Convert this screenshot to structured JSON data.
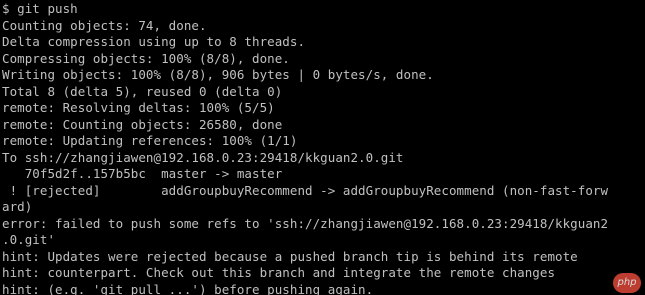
{
  "terminal": {
    "lines": [
      "$ git push",
      "Counting objects: 74, done.",
      "Delta compression using up to 8 threads.",
      "Compressing objects: 100% (8/8), done.",
      "Writing objects: 100% (8/8), 906 bytes | 0 bytes/s, done.",
      "Total 8 (delta 5), reused 0 (delta 0)",
      "remote: Resolving deltas: 100% (5/5)",
      "remote: Counting objects: 26580, done",
      "remote: Updating references: 100% (1/1)",
      "To ssh://zhangjiawen@192.168.0.23:29418/kkguan2.0.git",
      "   70f5d2f..157b5bc  master -> master",
      " ! [rejected]        addGroupbuyRecommend -> addGroupbuyRecommend (non-fast-forw",
      "ard)",
      "error: failed to push some refs to 'ssh://zhangjiawen@192.168.0.23:29418/kkguan2",
      ".0.git'",
      "hint: Updates were rejected because a pushed branch tip is behind its remote",
      "hint: counterpart. Check out this branch and integrate the remote changes",
      "hint: (e.g. 'git pull ...') before pushing again."
    ]
  },
  "watermark": {
    "text": "php"
  },
  "colors": {
    "background": "#000000",
    "text": "#c0c0c0",
    "watermark": "#e0483a"
  }
}
